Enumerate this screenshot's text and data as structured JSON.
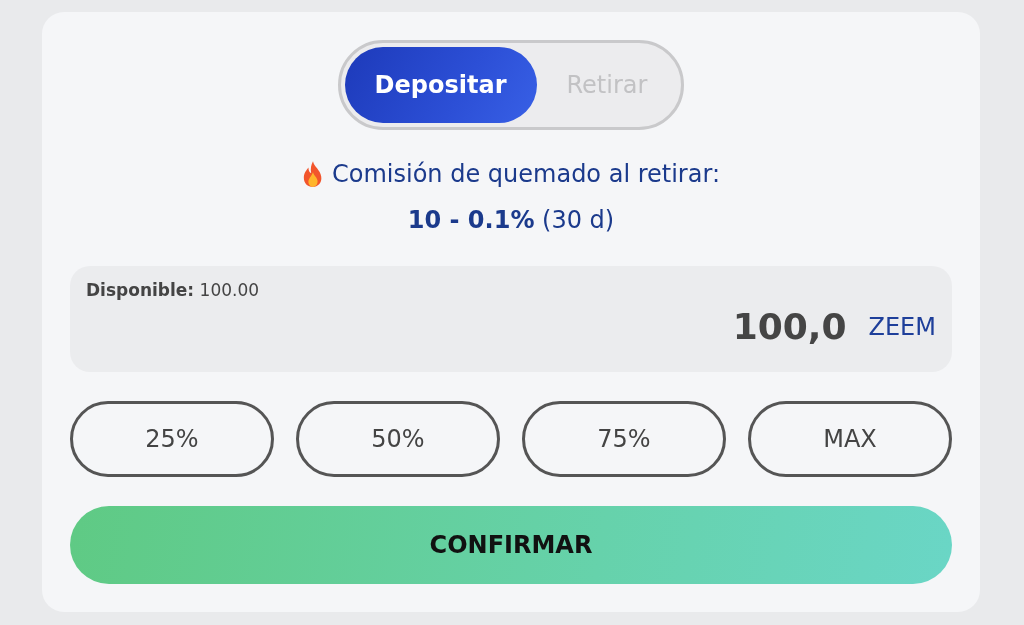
{
  "tabs": [
    {
      "label": "Depositar",
      "selected": true
    },
    {
      "label": "Retirar",
      "selected": false
    }
  ],
  "fee_notice": {
    "title": "Comisión de quemado al retirar:",
    "rate": "**10 - 0.1%** (30 d)"
  },
  "amount_panel": {
    "available": "**Disponible:** 100.00",
    "amount": "100,0",
    "currency": "ZEEM"
  },
  "percent_buttons": [
    "25%",
    "50%",
    "75%",
    "MAX"
  ],
  "confirm_button": "CONFIRMAR"
}
